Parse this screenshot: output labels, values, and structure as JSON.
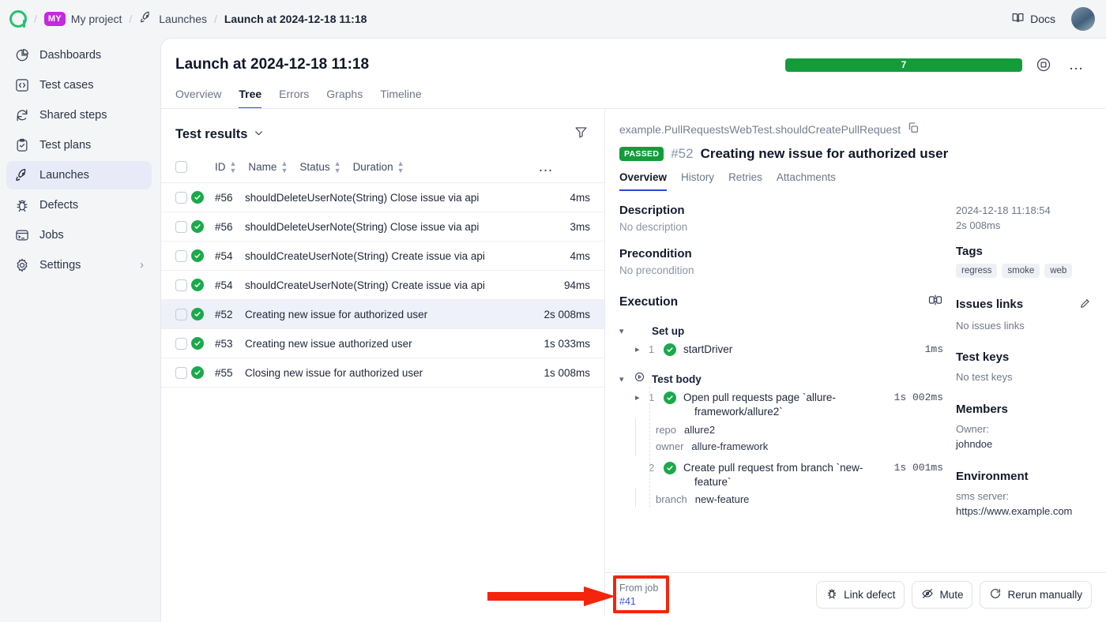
{
  "breadcrumb": {
    "logo": "allure-logo-icon",
    "project_badge": "MY",
    "project": "My project",
    "section": "Launches",
    "current": "Launch at 2024-12-18 11:18",
    "sep": "/"
  },
  "topbar": {
    "docs": "Docs",
    "docs_icon": "book-icon",
    "avatar": "user-avatar"
  },
  "sidebar": {
    "items": [
      {
        "label": "Dashboards",
        "icon": "pie-chart-icon",
        "active": false
      },
      {
        "label": "Test cases",
        "icon": "code-brackets-icon",
        "active": false
      },
      {
        "label": "Shared steps",
        "icon": "refresh-cycle-icon",
        "active": false
      },
      {
        "label": "Test plans",
        "icon": "clipboard-check-icon",
        "active": false
      },
      {
        "label": "Launches",
        "icon": "rocket-icon",
        "active": true
      },
      {
        "label": "Defects",
        "icon": "bug-icon",
        "active": false
      },
      {
        "label": "Jobs",
        "icon": "terminal-icon",
        "active": false
      },
      {
        "label": "Settings",
        "icon": "gear-icon",
        "active": false,
        "chevron": "›"
      }
    ]
  },
  "launch": {
    "title": "Launch at 2024-12-18 11:18",
    "progress_value": "7",
    "progress_color": "#149c3a",
    "tabs": [
      {
        "label": "Overview",
        "active": false
      },
      {
        "label": "Tree",
        "active": true
      },
      {
        "label": "Errors",
        "active": false
      },
      {
        "label": "Graphs",
        "active": false
      },
      {
        "label": "Timeline",
        "active": false
      }
    ]
  },
  "results": {
    "title": "Test results",
    "chevron": "⌄",
    "filter_icon": "filter-icon",
    "columns": [
      "ID",
      "Name",
      "Status",
      "Duration"
    ],
    "rows": [
      {
        "id": "#56",
        "name": "shouldDeleteUserNote(String) Close issue via api",
        "duration": "4ms",
        "status": "passed",
        "selected": false
      },
      {
        "id": "#56",
        "name": "shouldDeleteUserNote(String) Close issue via api",
        "duration": "3ms",
        "status": "passed",
        "selected": false
      },
      {
        "id": "#54",
        "name": "shouldCreateUserNote(String) Create issue via api",
        "duration": "4ms",
        "status": "passed",
        "selected": false
      },
      {
        "id": "#54",
        "name": "shouldCreateUserNote(String) Create issue via api",
        "duration": "94ms",
        "status": "passed",
        "selected": false
      },
      {
        "id": "#52",
        "name": "Creating new issue for authorized user",
        "duration": "2s 008ms",
        "status": "passed",
        "selected": true
      },
      {
        "id": "#53",
        "name": "Creating new issue authorized user",
        "duration": "1s 033ms",
        "status": "passed",
        "selected": false
      },
      {
        "id": "#55",
        "name": "Closing new issue for authorized user",
        "duration": "1s 008ms",
        "status": "passed",
        "selected": false
      }
    ]
  },
  "detail": {
    "full_name": "example.PullRequestsWebTest.shouldCreatePullRequest",
    "copy_icon": "copy-icon",
    "status_badge": "PASSED",
    "id": "#52",
    "title": "Creating new issue for authorized user",
    "tabs": [
      {
        "label": "Overview",
        "active": true
      },
      {
        "label": "History",
        "active": false
      },
      {
        "label": "Retries",
        "active": false
      },
      {
        "label": "Attachments",
        "active": false
      }
    ],
    "description_label": "Description",
    "description_value": "No description",
    "precondition_label": "Precondition",
    "precondition_value": "No precondition",
    "execution_label": "Execution",
    "execution_icon": "compare-steps-icon",
    "groups": [
      {
        "name": "Set up",
        "icon": "stopwatch-icon",
        "steps": [
          {
            "no": "1",
            "name": "startDriver",
            "duration": "1ms",
            "status": "passed",
            "expandable": true,
            "params": []
          }
        ]
      },
      {
        "name": "Test body",
        "icon": "play-circle-icon",
        "steps": [
          {
            "no": "1",
            "name": "Open pull requests page `allure-",
            "name2": "framework/allure2`",
            "duration": "1s  002ms",
            "status": "passed",
            "expandable": true,
            "params": [
              {
                "key": "repo",
                "value": "allure2"
              },
              {
                "key": "owner",
                "value": "allure-framework"
              }
            ]
          },
          {
            "no": "2",
            "name": "Create pull request from branch `new-",
            "name2": "feature`",
            "duration": "1s  001ms",
            "status": "passed",
            "expandable": false,
            "params": [
              {
                "key": "branch",
                "value": "new-feature"
              }
            ]
          }
        ]
      }
    ],
    "side": {
      "timestamp": "2024-12-18 11:18:54",
      "duration": "2s 008ms",
      "tags_label": "Tags",
      "tags": [
        "regress",
        "smoke",
        "web"
      ],
      "issues_label": "Issues links",
      "issues_edit_icon": "pencil-icon",
      "issues_value": "No issues links",
      "testkeys_label": "Test keys",
      "testkeys_value": "No test keys",
      "members_label": "Members",
      "owner_label": "Owner:",
      "owner_value": "johndoe",
      "environment_label": "Environment",
      "env_key": "sms server:",
      "env_value": "https://www.example.com"
    }
  },
  "bottombar": {
    "from_job_label": "From job",
    "from_job_id": "#41",
    "buttons": [
      {
        "label": "Link defect",
        "icon": "bug-icon"
      },
      {
        "label": "Mute",
        "icon": "eye-off-icon"
      },
      {
        "label": "Rerun manually",
        "icon": "rerun-icon"
      }
    ]
  },
  "annotation": {
    "arrow_color": "#f5240c",
    "box_color": "#f5240c",
    "arrow": "highlight-arrow",
    "box": "highlight-box"
  }
}
